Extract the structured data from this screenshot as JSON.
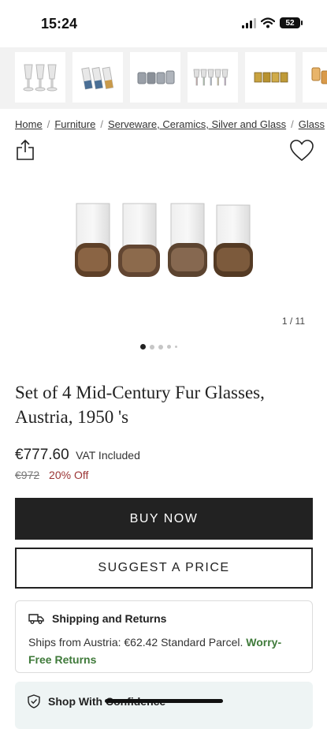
{
  "status_bar": {
    "time": "15:24",
    "battery": "52"
  },
  "thumbnails": [
    {
      "name": "stemmed-glasses"
    },
    {
      "name": "blue-base-glasses"
    },
    {
      "name": "grey-tumblers"
    },
    {
      "name": "colored-stem-glasses"
    },
    {
      "name": "gold-glasses"
    },
    {
      "name": "amber-glasses"
    }
  ],
  "breadcrumb": {
    "items": [
      "Home",
      "Furniture",
      "Serveware, Ceramics, Silver and Glass",
      "Glass"
    ],
    "separator": "/"
  },
  "gallery": {
    "counter": "1 / 11",
    "active_index": 0,
    "dot_count": 5
  },
  "product": {
    "title": "Set of 4 Mid-Century Fur Glasses, Austria, 1950 's",
    "price": "€777.60",
    "vat_note": "VAT Included",
    "original_price": "€972",
    "discount": "20% Off"
  },
  "actions": {
    "buy_now": "BUY NOW",
    "suggest_price": "SUGGEST A PRICE"
  },
  "shipping": {
    "title": "Shipping and Returns",
    "text": "Ships from Austria: €62.42 Standard Parcel.",
    "link": "Worry-Free Returns"
  },
  "confidence": {
    "title": "Shop With Confidence"
  },
  "colors": {
    "primary": "#222222",
    "discount": "#9b3434",
    "link_green": "#3f7a3a",
    "card_bg": "#eef4f4"
  }
}
